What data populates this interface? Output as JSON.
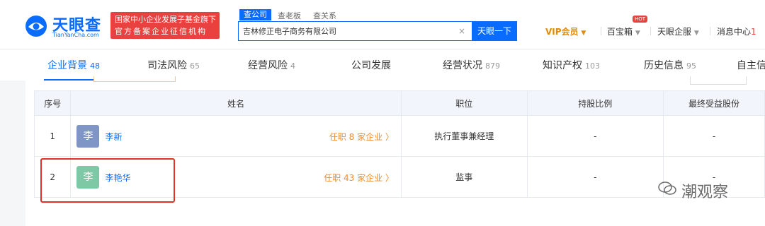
{
  "brand": {
    "name_cn": "天眼查",
    "name_en": "TianYanCha.com",
    "badge_line1": "国家中小企业发展子基金旗下",
    "badge_line2": "官方备案企业征信机构"
  },
  "search": {
    "tabs": [
      "查公司",
      "查老板",
      "查关系"
    ],
    "value": "吉林修正电子商务有限公司",
    "clear": "×",
    "button": "天眼一下"
  },
  "topnav": {
    "vip": "VIP会员",
    "treasure": "百宝箱",
    "hot": "HOT",
    "enterprise": "天眼企服",
    "messages": "消息中心",
    "messages_count": "1"
  },
  "tabs": [
    {
      "label": "企业背景",
      "count": "48"
    },
    {
      "label": "司法风险",
      "count": "65"
    },
    {
      "label": "经营风险",
      "count": "4"
    },
    {
      "label": "公司发展",
      "count": ""
    },
    {
      "label": "经营状况",
      "count": "879"
    },
    {
      "label": "知识产权",
      "count": "103"
    },
    {
      "label": "历史信息",
      "count": "95"
    },
    {
      "label": "自主信",
      "count": ""
    }
  ],
  "table": {
    "headers": [
      "序号",
      "姓名",
      "职位",
      "持股比例",
      "最终受益股份"
    ],
    "rows": [
      {
        "index": "1",
        "avatar": "李",
        "avatar_color": "#7e95c6",
        "name": "李新",
        "roles": "任职 8 家企业 〉",
        "position": "执行董事兼经理",
        "share": "-",
        "beneficial": "-"
      },
      {
        "index": "2",
        "avatar": "李",
        "avatar_color": "#7ec8a5",
        "name": "李艳华",
        "roles": "任职 43 家企业 〉",
        "position": "监事",
        "share": "-",
        "beneficial": "-"
      }
    ]
  },
  "watermark": "潮观察"
}
